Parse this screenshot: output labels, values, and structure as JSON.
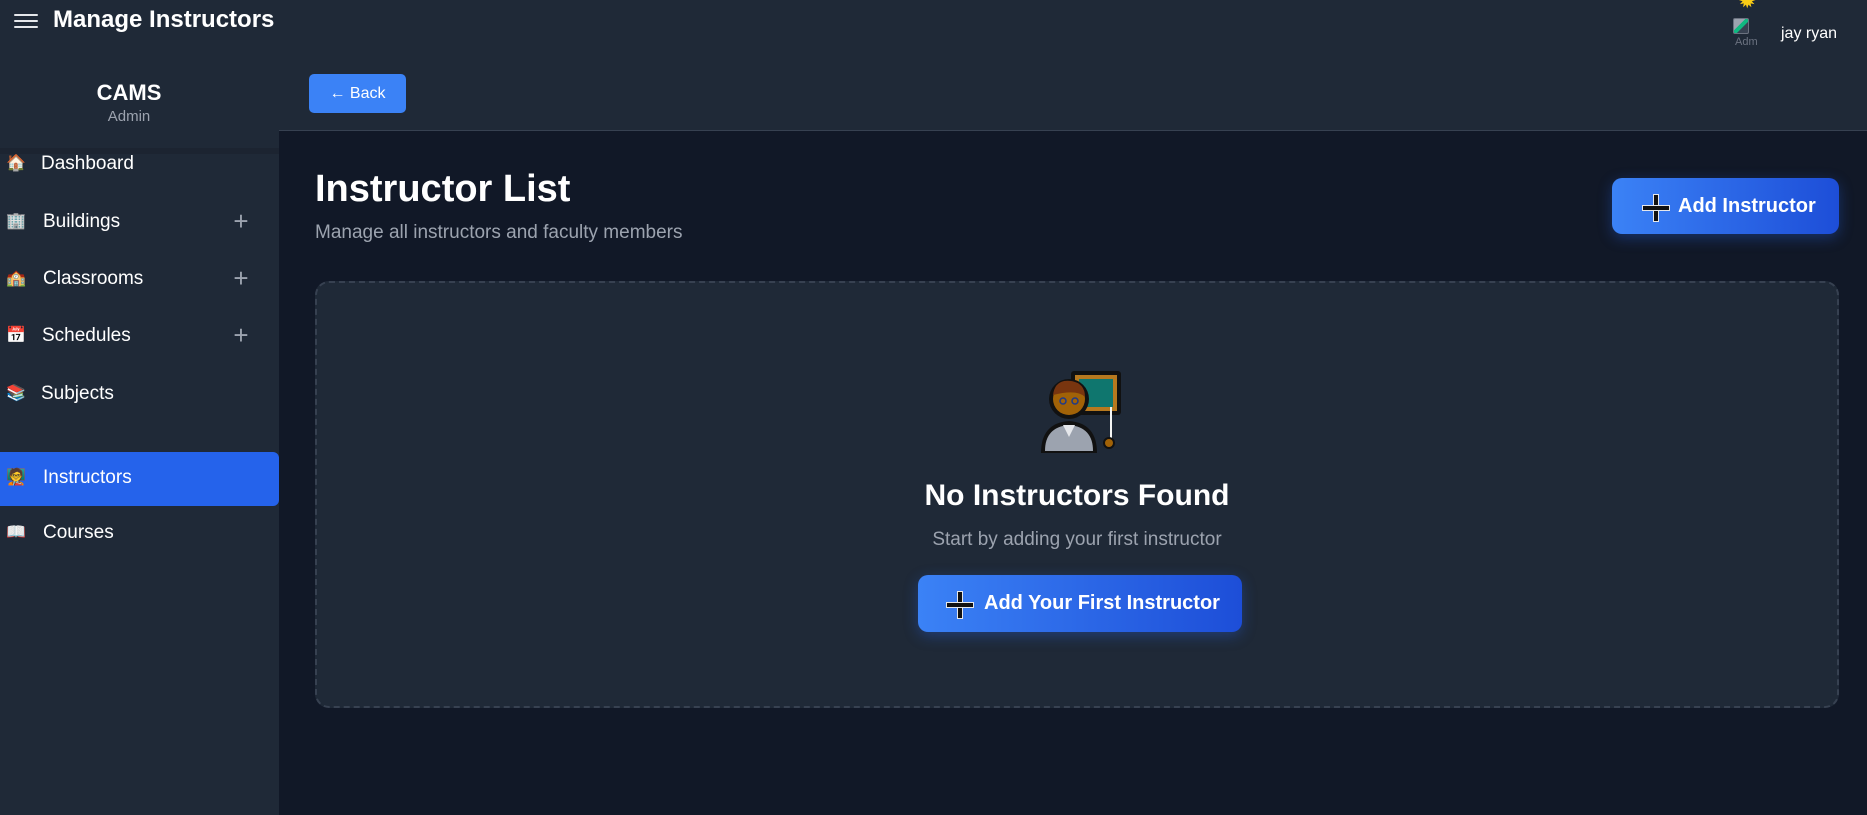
{
  "header": {
    "title": "Manage Instructors",
    "user": {
      "name": "jay ryan",
      "avatar_alt": "Adm"
    }
  },
  "sidebar": {
    "brand": {
      "name": "CAMS",
      "role": "Admin"
    },
    "items": [
      {
        "label": "Dashboard",
        "icon": "house-icon",
        "expandable": false,
        "active": false
      },
      {
        "label": "Buildings",
        "icon": "building-icon",
        "expandable": true,
        "active": false
      },
      {
        "label": "Classrooms",
        "icon": "school-icon",
        "expandable": true,
        "active": false
      },
      {
        "label": "Schedules",
        "icon": "calendar-icon",
        "expandable": true,
        "active": false
      },
      {
        "label": "Subjects",
        "icon": "books-icon",
        "expandable": false,
        "active": false
      },
      {
        "label": "Instructors",
        "icon": "teacher-icon",
        "expandable": false,
        "active": true
      },
      {
        "label": "Courses",
        "icon": "open-book-icon",
        "expandable": false,
        "active": false
      }
    ]
  },
  "toolbar": {
    "back_label": "← Back"
  },
  "main": {
    "title": "Instructor List",
    "subtitle": "Manage all instructors and faculty members",
    "add_button_label": "Add Instructor",
    "empty_state": {
      "title": "No Instructors Found",
      "subtitle": "Start by adding your first instructor",
      "button_label": "Add Your First Instructor"
    }
  },
  "colors": {
    "accent": "#2563eb",
    "button": "#3b82f6",
    "background": "#111827",
    "panel": "#1f2937",
    "muted_text": "#9ca3af"
  }
}
